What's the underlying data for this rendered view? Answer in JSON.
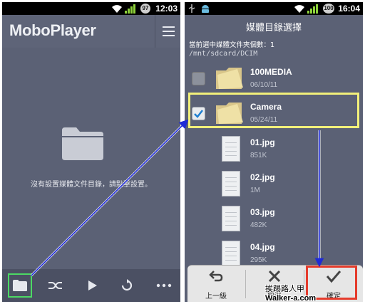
{
  "left_phone": {
    "status_bar": {
      "battery": "97",
      "time": "12:03"
    },
    "app_title": "MoboPlayer",
    "empty_message": "沒有設置媒體文件目錄，請點擊設置。",
    "bottom_bar": [
      "folder-icon",
      "shuffle-icon",
      "play-icon",
      "repeat-icon",
      "more-icon"
    ]
  },
  "right_phone": {
    "status_bar": {
      "battery": "100",
      "time": "16:04"
    },
    "title": "媒體目錄選擇",
    "selected_count_text": "當前選中媒體文件夾個數：1",
    "path": "/mnt/sdcard/DCIM",
    "folders": [
      {
        "name": "100MEDIA",
        "date": "06/10/11",
        "checked": false
      },
      {
        "name": "Camera",
        "date": "05/24/11",
        "checked": true
      }
    ],
    "files": [
      {
        "name": "01.jpg",
        "size": "851K"
      },
      {
        "name": "02.jpg",
        "size": "1M"
      },
      {
        "name": "03.jpg",
        "size": "482K"
      },
      {
        "name": "04.jpg",
        "size": "295K"
      }
    ],
    "actions": {
      "up": "上一級",
      "cancel": "取消",
      "confirm": "確定"
    }
  },
  "watermark": {
    "author": "挨踢路人甲",
    "site": "Walker-a.com"
  },
  "colors": {
    "highlight_green": "#4cd964",
    "highlight_yellow": "#f2f07a",
    "highlight_red": "#e53b2c",
    "arrow_blue": "#1f2bd6"
  }
}
